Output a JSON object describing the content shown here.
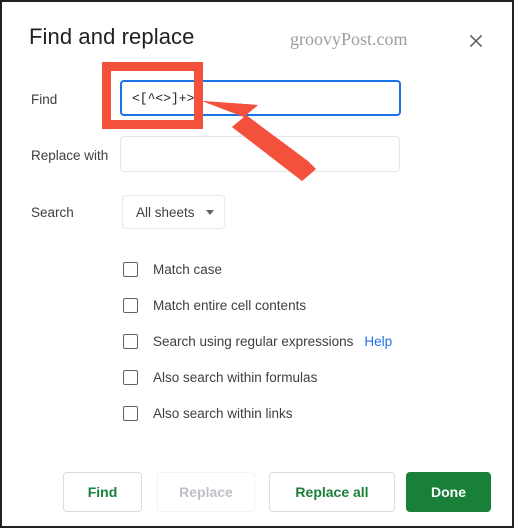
{
  "dialog": {
    "title": "Find and replace",
    "watermark": "groovyPost.com",
    "close_icon": "close-icon"
  },
  "form": {
    "find": {
      "label": "Find",
      "value": "<[^<>]+>",
      "placeholder": ""
    },
    "replace": {
      "label": "Replace with",
      "value": "",
      "placeholder": ""
    },
    "search": {
      "label": "Search",
      "selected": "All sheets",
      "caret_icon": "chevron-down-icon"
    }
  },
  "options": [
    {
      "label": "Match case",
      "checked": false
    },
    {
      "label": "Match entire cell contents",
      "checked": false
    },
    {
      "label": "Search using regular expressions",
      "checked": false,
      "help": "Help"
    },
    {
      "label": "Also search within formulas",
      "checked": false
    },
    {
      "label": "Also search within links",
      "checked": false
    }
  ],
  "footer": {
    "find_label": "Find",
    "replace_label": "Replace",
    "replace_all_label": "Replace all",
    "done_label": "Done"
  },
  "colors": {
    "accent_green": "#188038",
    "link_blue": "#1a73e8",
    "focus_blue": "#1a73e8",
    "annotation_red": "#f4513c",
    "text_primary": "#202124",
    "text_secondary": "#3c4043",
    "disabled_grey": "#bdc1c6"
  },
  "annotations": {
    "highlight_rect": "find-field-highlight",
    "arrow": "pointer-arrow"
  }
}
